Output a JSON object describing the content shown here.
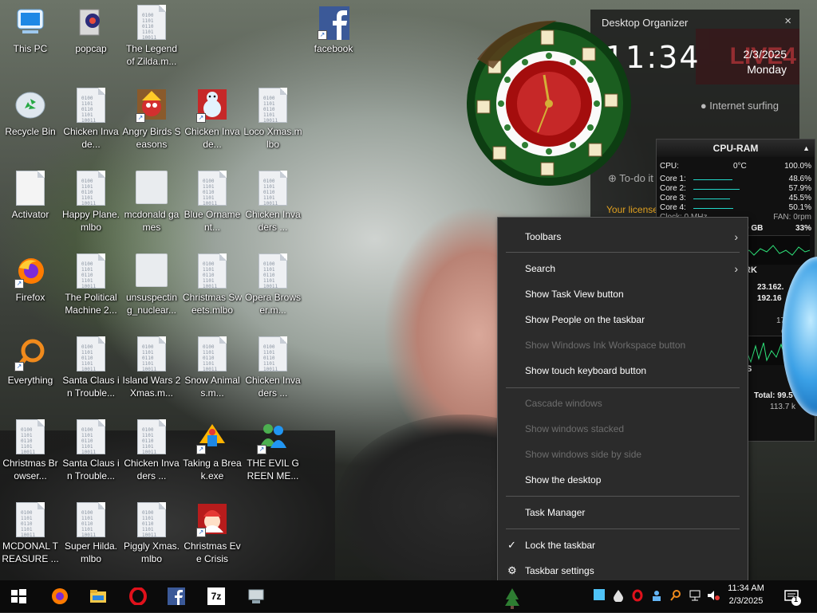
{
  "desktop": {
    "icons": [
      {
        "label": "This PC"
      },
      {
        "label": "popcap"
      },
      {
        "label": "The Legend of Zilda.m..."
      },
      {
        "label": "facebook"
      },
      {
        "label": "Recycle Bin"
      },
      {
        "label": "Chicken Invade..."
      },
      {
        "label": "Angry Birds Seasons"
      },
      {
        "label": "Chicken Invade..."
      },
      {
        "label": "Loco Xmas.mlbo"
      },
      {
        "label": "Activator"
      },
      {
        "label": "Happy Plane.mlbo"
      },
      {
        "label": "mcdonald games"
      },
      {
        "label": "Blue Ornament..."
      },
      {
        "label": "Chicken Invaders ..."
      },
      {
        "label": "Firefox"
      },
      {
        "label": "The Political Machine 2..."
      },
      {
        "label": "unsuspectin g_nuclear..."
      },
      {
        "label": "Christmas Sweets.mlbo"
      },
      {
        "label": "Opera Browser.m..."
      },
      {
        "label": "Everything"
      },
      {
        "label": "Santa Claus in Trouble..."
      },
      {
        "label": "Island Wars 2 Xmas.m..."
      },
      {
        "label": "Snow Animals.m..."
      },
      {
        "label": "Chicken Invaders ..."
      },
      {
        "label": "Christmas Browser..."
      },
      {
        "label": "Santa Claus in Trouble..."
      },
      {
        "label": "Chicken Invaders ..."
      },
      {
        "label": "Taking a Break.exe"
      },
      {
        "label": "THE EVIL GREEN ME..."
      },
      {
        "label": "MCDONAL TREASURE ..."
      },
      {
        "label": "Super Hilda.mlbo"
      },
      {
        "label": "Piggly Xmas.mlbo"
      },
      {
        "label": "Christmas Eve Crisis"
      }
    ],
    "file_bits": "0100\n1101\n0110\n1101\n10011"
  },
  "organizer": {
    "title": "Desktop Organizer",
    "close": "×",
    "time": "11:34",
    "date": "2/3/2025",
    "day": "Monday",
    "surfing": "Internet surfing",
    "live_text": "LIVE4",
    "todo": "To-do it",
    "license": "Your license"
  },
  "cpuram": {
    "title": "CPU-RAM",
    "cpu_label": "CPU:",
    "cpu_temp": "0°C",
    "cpu_total": "100.0%",
    "cores": [
      {
        "label": "Core 1:",
        "value": "48.6%",
        "level": 0.486
      },
      {
        "label": "Core 2:",
        "value": "57.9%",
        "level": 0.579
      },
      {
        "label": "Core 3:",
        "value": "45.5%",
        "level": 0.455
      },
      {
        "label": "Core 4:",
        "value": "50.1%",
        "level": 0.501
      }
    ],
    "clock_text": "Clock: 0 MHz",
    "fan_text": "FAN: 0rpm",
    "ram_text": "0 GB",
    "ram_pct": "33%",
    "net_label": "RK",
    "net_ip1": "23.162.",
    "net_ip2": "192.16",
    "net_val": "178",
    "net_val2": "6",
    "disk_label": "S",
    "disk_pct": "0",
    "total_text": "Total: 99.5",
    "total_sub": "113.7 k"
  },
  "context_menu": {
    "items": [
      {
        "label": "Toolbars",
        "submenu": true
      },
      {
        "label": "Search",
        "submenu": true
      },
      {
        "label": "Show Task View button"
      },
      {
        "label": "Show People on the taskbar"
      },
      {
        "label": "Show Windows Ink Workspace button",
        "disabled": true
      },
      {
        "label": "Show touch keyboard button"
      },
      {
        "label": "Cascade windows",
        "disabled": true
      },
      {
        "label": "Show windows stacked",
        "disabled": true
      },
      {
        "label": "Show windows side by side",
        "disabled": true
      },
      {
        "label": "Show the desktop"
      },
      {
        "label": "Task Manager"
      },
      {
        "label": "Lock the taskbar",
        "checked": true
      },
      {
        "label": "Taskbar settings",
        "icon": "gear-icon"
      }
    ],
    "arrow": "›",
    "check": "✓"
  },
  "taskbar": {
    "pinned": [
      "start-icon",
      "firefox-icon",
      "file-explorer-icon",
      "opera-icon",
      "facebook-icon",
      "7zip-icon",
      "network-drive-icon"
    ],
    "clock_time": "11:34 AM",
    "clock_date": "2/3/2025",
    "notifications": "1",
    "sevenzip": "7z"
  },
  "colors": {
    "menu_bg": "#2b2b2b",
    "taskbar_bg": "#0b0b0b",
    "facebook": "#3b5998",
    "opera": "#e0111b",
    "firefox": "#ff7b00"
  }
}
